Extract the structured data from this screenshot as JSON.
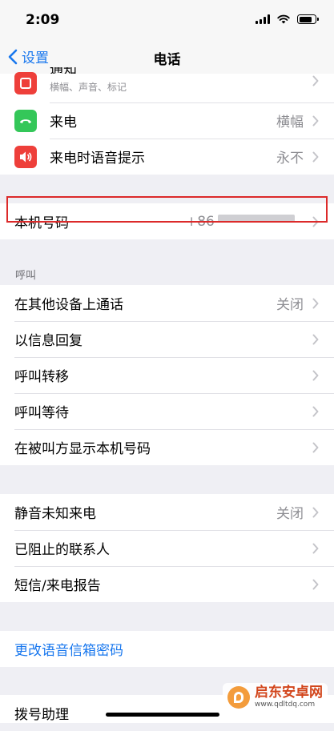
{
  "status_bar": {
    "time": "2:09"
  },
  "nav": {
    "back_label": "设置",
    "title": "电话"
  },
  "group1": {
    "rows": [
      {
        "label": "通知",
        "sublabel": "横幅、声音、标记",
        "icon": "notification-icon",
        "icon_color": "#ee3f3a"
      },
      {
        "label": "来电",
        "value": "横幅",
        "icon": "phone-icon",
        "icon_color": "#34c759"
      },
      {
        "label": "来电时语音提示",
        "value": "永不",
        "icon": "speaker-icon",
        "icon_color": "#ee3f3a"
      }
    ]
  },
  "my_number": {
    "label": "本机号码",
    "value": "+86"
  },
  "calls_section": {
    "header": "呼叫",
    "rows": [
      {
        "label": "在其他设备上通话",
        "value": "关闭"
      },
      {
        "label": "以信息回复"
      },
      {
        "label": "呼叫转移"
      },
      {
        "label": "呼叫等待"
      },
      {
        "label": "在被叫方显示本机号码"
      }
    ]
  },
  "group3": {
    "rows": [
      {
        "label": "静音未知来电",
        "value": "关闭"
      },
      {
        "label": "已阻止的联系人"
      },
      {
        "label": "短信/来电报告"
      }
    ]
  },
  "voicemail": {
    "label": "更改语音信箱密码"
  },
  "dial_assist": {
    "label": "拨号助理"
  },
  "watermark": {
    "title": "启东安卓网",
    "url": "www.qdltdq.com"
  },
  "colors": {
    "accent": "#1877ee",
    "highlight_border": "#dc2a2a",
    "background": "#efeff4"
  }
}
